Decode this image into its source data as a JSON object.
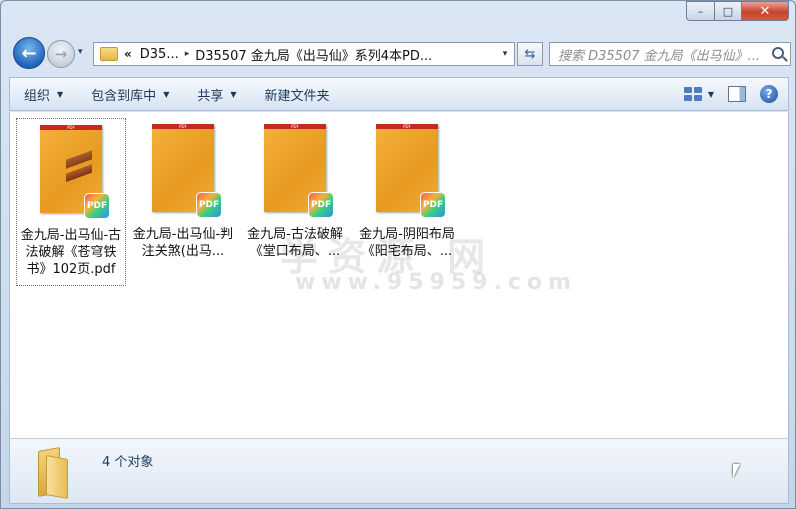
{
  "window": {
    "caption": {
      "minimize": "–",
      "maximize": "□",
      "close": "✕"
    }
  },
  "nav": {
    "back_glyph": "←",
    "forward_glyph": "→",
    "history_glyph": "▾",
    "breadcrumb": {
      "overflow": "«",
      "items": [
        "D35...",
        "D35507 金九局《出马仙》系列4本PD..."
      ],
      "separator": "▸"
    },
    "address_dropdown": "▾",
    "refresh_glyph": "⇆",
    "search": {
      "placeholder": "搜索 D35507 金九局《出马仙》..."
    }
  },
  "toolbar": {
    "organize": "组织",
    "include_in_library": "包含到库中",
    "share": "共享",
    "new_folder": "新建文件夹",
    "caret": "▼",
    "help": "?"
  },
  "files": [
    {
      "label": "金九局-出马仙-古法破解《苍穹铁书》102页.pdf",
      "selected": true,
      "badge": "PDF",
      "band": "PDF"
    },
    {
      "label": "金九局-出马仙-判注关煞(出马...",
      "selected": false,
      "badge": "PDF",
      "band": "PDF"
    },
    {
      "label": "金九局-古法破解《堂口布局、...",
      "selected": false,
      "badge": "PDF",
      "band": "PDF"
    },
    {
      "label": "金九局-阴阳布局《阳宅布局、...",
      "selected": false,
      "badge": "PDF",
      "band": "PDF"
    }
  ],
  "watermark": {
    "text": "学资源 网",
    "url": "www.95959.com"
  },
  "details": {
    "count": "4 个对象"
  }
}
